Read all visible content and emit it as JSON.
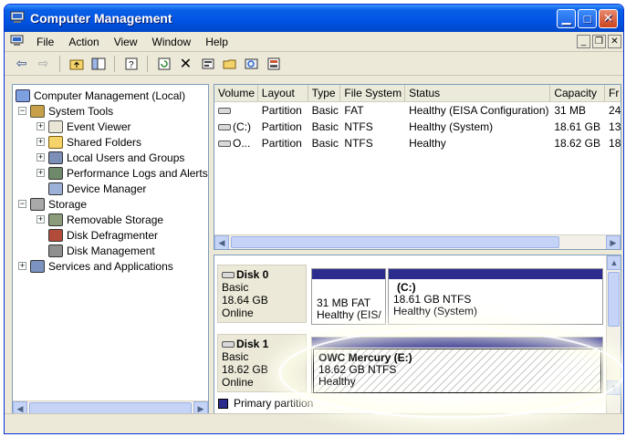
{
  "window": {
    "title": "Computer Management"
  },
  "menu": [
    "File",
    "Action",
    "View",
    "Window",
    "Help"
  ],
  "mdi": {
    "minimize": "_",
    "restore": "❐",
    "close": "✕"
  },
  "toolbar": [
    "back",
    "forward",
    "up-folder",
    "show-hide-tree",
    "help",
    "refresh",
    "delete",
    "properties",
    "open",
    "search",
    "properties-sheet"
  ],
  "tree": {
    "root": "Computer Management (Local)",
    "system_tools": "System Tools",
    "event_viewer": "Event Viewer",
    "shared_folders": "Shared Folders",
    "local_users": "Local Users and Groups",
    "perf_logs": "Performance Logs and Alerts",
    "device_manager": "Device Manager",
    "storage": "Storage",
    "removable_storage": "Removable Storage",
    "disk_defrag": "Disk Defragmenter",
    "disk_management": "Disk Management",
    "services": "Services and Applications"
  },
  "volume_columns": [
    "Volume",
    "Layout",
    "Type",
    "File System",
    "Status",
    "Capacity",
    "Fr"
  ],
  "volumes": [
    {
      "volume": "",
      "layout": "Partition",
      "type": "Basic",
      "fs": "FAT",
      "status": "Healthy (EISA Configuration)",
      "capacity": "31 MB",
      "free": "24"
    },
    {
      "volume": "(C:)",
      "layout": "Partition",
      "type": "Basic",
      "fs": "NTFS",
      "status": "Healthy (System)",
      "capacity": "18.61 GB",
      "free": "13"
    },
    {
      "volume": "O...",
      "layout": "Partition",
      "type": "Basic",
      "fs": "NTFS",
      "status": "Healthy",
      "capacity": "18.62 GB",
      "free": "18"
    }
  ],
  "disk0": {
    "name": "Disk 0",
    "type": "Basic",
    "size": "18.64 GB",
    "state": "Online",
    "p1": {
      "line1": "31 MB FAT",
      "line2": "Healthy (EIS/"
    },
    "p2": {
      "title": "(C:)",
      "line1": "18.61 GB NTFS",
      "line2": "Healthy (System)"
    }
  },
  "disk1": {
    "name": "Disk 1",
    "type": "Basic",
    "size": "18.62 GB",
    "state": "Online",
    "p1": {
      "title": "OWC Mercury  (E:)",
      "line1": "18.62 GB NTFS",
      "line2": "Healthy"
    }
  },
  "legend": {
    "primary": "Primary partition"
  },
  "colors": {
    "titlebar": "#0054e3",
    "partition_bar": "#2c2c8e",
    "highlight": "#ffffff"
  }
}
